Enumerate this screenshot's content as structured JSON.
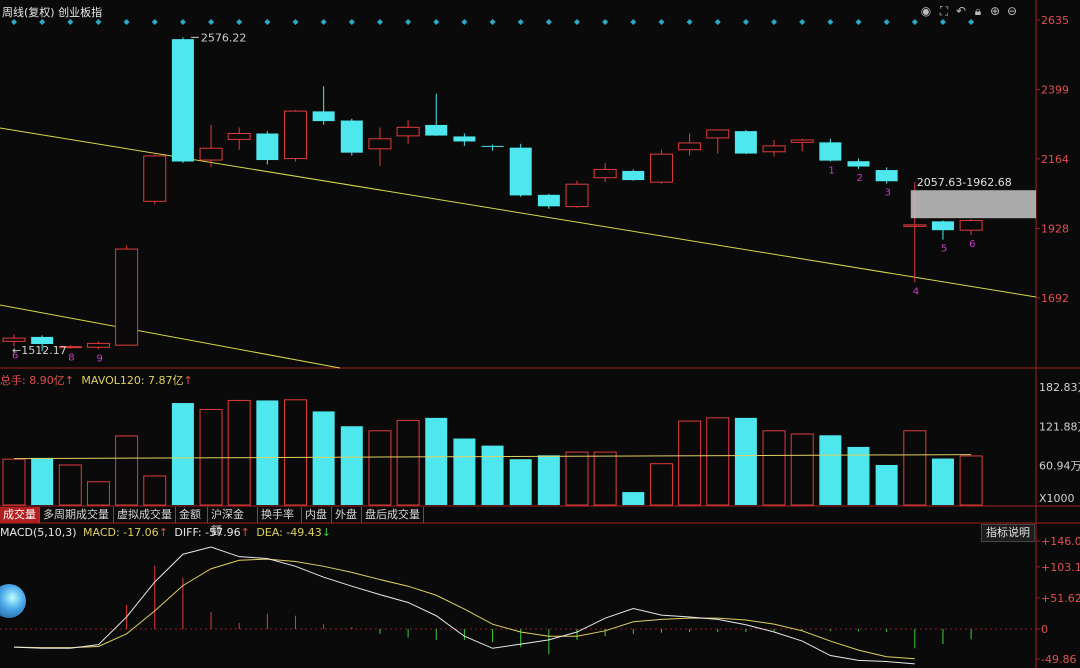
{
  "header": {
    "title": "周线(复权) 创业板指",
    "icons": [
      "eye-icon",
      "fullscreen-icon",
      "undo-icon",
      "lock-icon",
      "zoom-in-icon",
      "zoom-out-icon"
    ]
  },
  "colors": {
    "up": "#e03b3b",
    "down": "#4fe7ee",
    "trendline": "#d8d84a",
    "ma_line": "#e0d060",
    "diff": "#e8e8e8",
    "dea": "#e0d060",
    "axis_text_main": "#e05050",
    "axis_text_vol": "#d0d0d0",
    "marker": "#2aa9c9",
    "annotation": "#c040c0"
  },
  "price_axis": {
    "ticks": [
      "2635",
      "2399",
      "2164",
      "1928",
      "1692"
    ]
  },
  "volume_axis": {
    "ticks": [
      "182.83万",
      "121.88万",
      "60.94万",
      "X1000"
    ]
  },
  "macd_axis": {
    "ticks": [
      "+146.0",
      "+103.1",
      "+51.62",
      "0",
      "-49.86"
    ]
  },
  "volume_info": {
    "total_label": "总手: 8.90亿",
    "total_arrow": "↑",
    "ma_label": "MAVOL120: 7.87亿",
    "ma_arrow": "↑"
  },
  "macd_info": {
    "name": "MACD(5,10,3)",
    "macd": "MACD: -17.06",
    "macd_arrow": "↑",
    "diff": "DIFF: -57.96",
    "diff_arrow": "↑",
    "dea": "DEA: -49.43",
    "dea_arrow": "↓"
  },
  "tabs": [
    "成交量",
    "多周期成交量",
    "虚拟成交量",
    "金额",
    "沪深金额",
    "换手率",
    "内盘",
    "外盘",
    "盘后成交量"
  ],
  "indicator_button": "指标说明",
  "annotations": {
    "high_label": "2576.22",
    "low_label": "1512.17",
    "range_label": "2057.63-1962.68"
  },
  "chart_data": {
    "type": "candlestick",
    "period": "weekly",
    "price_range": [
      1512.17,
      2635
    ],
    "candles": [
      {
        "o": 1545,
        "h": 1568,
        "l": 1528,
        "c": 1556,
        "vol": 71,
        "num": "6"
      },
      {
        "o": 1560,
        "h": 1565,
        "l": 1512,
        "c": 1536,
        "vol": 73,
        "num": ""
      },
      {
        "o": 1527,
        "h": 1532,
        "l": 1520,
        "c": 1527,
        "vol": 62,
        "num": "8"
      },
      {
        "o": 1525,
        "h": 1545,
        "l": 1518,
        "c": 1538,
        "vol": 36,
        "num": "9"
      },
      {
        "o": 1532,
        "h": 1870,
        "l": 1530,
        "c": 1858,
        "vol": 107,
        "num": ""
      },
      {
        "o": 2020,
        "h": 2178,
        "l": 2010,
        "c": 2174,
        "vol": 45,
        "num": ""
      },
      {
        "o": 2570,
        "h": 2576.22,
        "l": 2150,
        "c": 2155,
        "vol": 158,
        "num": ""
      },
      {
        "o": 2160,
        "h": 2280,
        "l": 2135,
        "c": 2200,
        "vol": 148,
        "num": ""
      },
      {
        "o": 2230,
        "h": 2270,
        "l": 2195,
        "c": 2250,
        "vol": 162,
        "num": ""
      },
      {
        "o": 2250,
        "h": 2258,
        "l": 2145,
        "c": 2160,
        "vol": 162,
        "num": ""
      },
      {
        "o": 2165,
        "h": 2330,
        "l": 2155,
        "c": 2326,
        "vol": 163,
        "num": ""
      },
      {
        "o": 2325,
        "h": 2410,
        "l": 2280,
        "c": 2292,
        "vol": 145,
        "num": ""
      },
      {
        "o": 2294,
        "h": 2300,
        "l": 2175,
        "c": 2185,
        "vol": 122,
        "num": ""
      },
      {
        "o": 2198,
        "h": 2270,
        "l": 2140,
        "c": 2232,
        "vol": 115,
        "num": ""
      },
      {
        "o": 2242,
        "h": 2295,
        "l": 2215,
        "c": 2271,
        "vol": 131,
        "num": ""
      },
      {
        "o": 2279,
        "h": 2385,
        "l": 2242,
        "c": 2243,
        "vol": 135,
        "num": ""
      },
      {
        "o": 2240,
        "h": 2250,
        "l": 2208,
        "c": 2223,
        "vol": 103,
        "num": ""
      },
      {
        "o": 2208,
        "h": 2212,
        "l": 2192,
        "c": 2206,
        "vol": 92,
        "num": ""
      },
      {
        "o": 2202,
        "h": 2215,
        "l": 2035,
        "c": 2040,
        "vol": 71,
        "num": ""
      },
      {
        "o": 2042,
        "h": 2045,
        "l": 1995,
        "c": 2003,
        "vol": 77,
        "num": ""
      },
      {
        "o": 2002,
        "h": 2090,
        "l": 1998,
        "c": 2078,
        "vol": 82,
        "num": ""
      },
      {
        "o": 2100,
        "h": 2150,
        "l": 2085,
        "c": 2128,
        "vol": 82,
        "num": ""
      },
      {
        "o": 2123,
        "h": 2128,
        "l": 2090,
        "c": 2092,
        "vol": 20,
        "num": ""
      },
      {
        "o": 2085,
        "h": 2195,
        "l": 2080,
        "c": 2180,
        "vol": 64,
        "num": ""
      },
      {
        "o": 2195,
        "h": 2250,
        "l": 2175,
        "c": 2218,
        "vol": 130,
        "num": ""
      },
      {
        "o": 2235,
        "h": 2265,
        "l": 2182,
        "c": 2262,
        "vol": 135,
        "num": ""
      },
      {
        "o": 2258,
        "h": 2262,
        "l": 2180,
        "c": 2182,
        "vol": 135,
        "num": ""
      },
      {
        "o": 2188,
        "h": 2228,
        "l": 2172,
        "c": 2208,
        "vol": 115,
        "num": ""
      },
      {
        "o": 2220,
        "h": 2232,
        "l": 2190,
        "c": 2228,
        "vol": 110,
        "num": ""
      },
      {
        "o": 2220,
        "h": 2232,
        "l": 2155,
        "c": 2158,
        "vol": 108,
        "num": "1"
      },
      {
        "o": 2156,
        "h": 2165,
        "l": 2130,
        "c": 2138,
        "vol": 90,
        "num": "2"
      },
      {
        "o": 2126,
        "h": 2135,
        "l": 2080,
        "c": 2088,
        "vol": 62,
        "num": "3"
      },
      {
        "o": 1935,
        "h": 2085,
        "l": 1745,
        "c": 1940,
        "vol": 115,
        "num": "4"
      },
      {
        "o": 1952,
        "h": 1955,
        "l": 1890,
        "c": 1922,
        "vol": 72,
        "num": "5"
      },
      {
        "o": 1922,
        "h": 1960,
        "l": 1905,
        "c": 1955,
        "vol": 76,
        "num": "6"
      }
    ],
    "volume_ma120": 75,
    "volume_range": [
      0,
      182.83
    ],
    "gap_zone": [
      1962.68,
      2057.63
    ],
    "macd": {
      "range": [
        -49.86,
        146.0
      ],
      "hist": [
        0,
        0,
        0,
        0,
        40,
        105,
        85,
        28,
        10,
        25,
        22,
        8,
        3,
        -8,
        -14,
        -18,
        -18,
        -22,
        -30,
        -42,
        -18,
        -12,
        -8,
        -6,
        -5,
        -5,
        -5,
        -4,
        -3,
        -3,
        -4,
        -5,
        -32,
        -25,
        -17.06
      ],
      "diff": [
        -30,
        -32,
        -32,
        -26,
        20,
        78,
        124,
        136,
        120,
        117,
        104,
        86,
        71,
        57,
        44,
        22,
        -12,
        -32,
        -25,
        -18,
        -5,
        18,
        34,
        23,
        20,
        16,
        7,
        -5,
        -20,
        -44,
        -52,
        -54,
        -57.96
      ],
      "dea": [
        -30,
        -31,
        -31,
        -29,
        -8,
        30,
        72,
        100,
        114,
        116,
        112,
        104,
        94,
        82,
        71,
        56,
        33,
        8,
        -5,
        -12,
        -12,
        -3,
        12,
        16,
        18,
        18,
        15,
        8,
        -3,
        -20,
        -35,
        -46,
        -49.43
      ]
    }
  }
}
